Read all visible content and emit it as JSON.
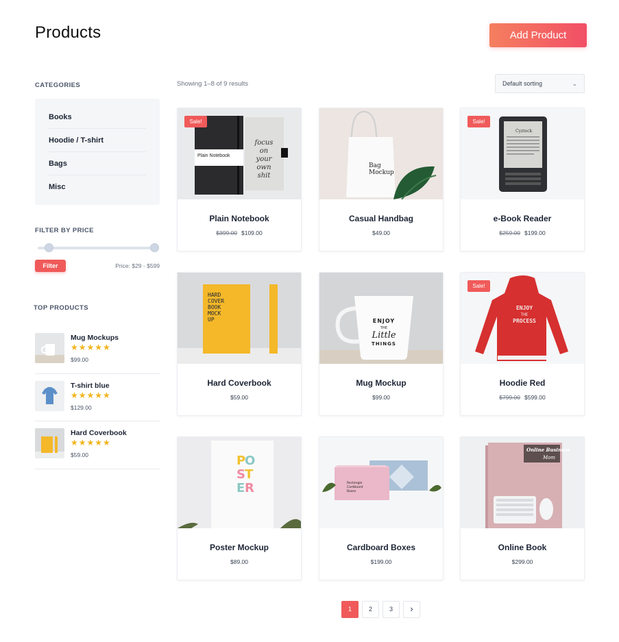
{
  "header": {
    "title": "Products",
    "add_button": "Add Product"
  },
  "sidebar": {
    "categories_heading": "CATEGORIES",
    "categories": [
      "Books",
      "Hoodie / T-shirt",
      "Bags",
      "Misc"
    ],
    "price_heading": "FILTER BY PRICE",
    "filter_button": "Filter",
    "price_range": "Price: $29 - $599",
    "price_slider": {
      "min": 29,
      "max": 599,
      "selected_min": 29,
      "selected_max": 599
    },
    "top_heading": "TOP PRODUCTS",
    "top_products": [
      {
        "name": "Mug Mockups",
        "stars": "★★★★★",
        "rating": 5,
        "price": "$99.00"
      },
      {
        "name": "T-shirt blue",
        "stars": "★★★★★",
        "rating": 5,
        "price": "$129.00"
      },
      {
        "name": "Hard Coverbook",
        "stars": "★★★★★",
        "rating": 5,
        "price": "$59.00"
      }
    ]
  },
  "toolbar": {
    "showing": "Showing 1–8 of 9 results",
    "sort_selected": "Default sorting",
    "sort_chevron": "⌄"
  },
  "products": [
    {
      "name": "Plain Notebook",
      "sale": "Sale!",
      "old_price": "$399.00",
      "price": "$109.00"
    },
    {
      "name": "Casual Handbag",
      "sale": "",
      "old_price": "",
      "price": "$49.00"
    },
    {
      "name": "e-Book Reader",
      "sale": "Sale!",
      "old_price": "$259.00",
      "price": "$199.00"
    },
    {
      "name": "Hard Coverbook",
      "sale": "",
      "old_price": "",
      "price": "$59.00"
    },
    {
      "name": "Mug Mockup",
      "sale": "",
      "old_price": "",
      "price": "$99.00"
    },
    {
      "name": "Hoodie Red",
      "sale": "Sale!",
      "old_price": "$799.00",
      "price": "$599.00"
    },
    {
      "name": "Poster Mockup",
      "sale": "",
      "old_price": "",
      "price": "$89.00"
    },
    {
      "name": "Cardboard Boxes",
      "sale": "",
      "old_price": "",
      "price": "$199.00"
    },
    {
      "name": "Online Book",
      "sale": "",
      "old_price": "",
      "price": "$299.00"
    }
  ],
  "product_images": {
    "notebook_label": "Plain Notebook",
    "notebook_script": [
      "focus",
      "on",
      "your",
      "own",
      "shit"
    ],
    "bag_label": [
      "Bag",
      "Mockup"
    ],
    "ereader_brand": "Cyzteck",
    "cover_text": [
      "HARD",
      "COVER",
      "BOOK",
      "MOCK",
      "UP"
    ],
    "mug_text": [
      "ENJOY",
      "THE",
      "Little",
      "THINGS"
    ],
    "hoodie_text": [
      "ENJOY",
      "THE",
      "PROCESS"
    ],
    "poster_letters": [
      "P",
      "O",
      "S",
      "T",
      "E",
      "R"
    ],
    "box_text": [
      "Rectangle",
      "Cardboard",
      "Boxes"
    ],
    "book_title": [
      "Online Business",
      "Mom"
    ]
  },
  "pagination": {
    "pages": [
      "1",
      "2",
      "3"
    ],
    "current": "1",
    "next": "›"
  },
  "colors": {
    "accent": "#f05a5a",
    "gradient_start": "#f57f5f",
    "gradient_end": "#f24f66",
    "star": "#f3b41b"
  }
}
